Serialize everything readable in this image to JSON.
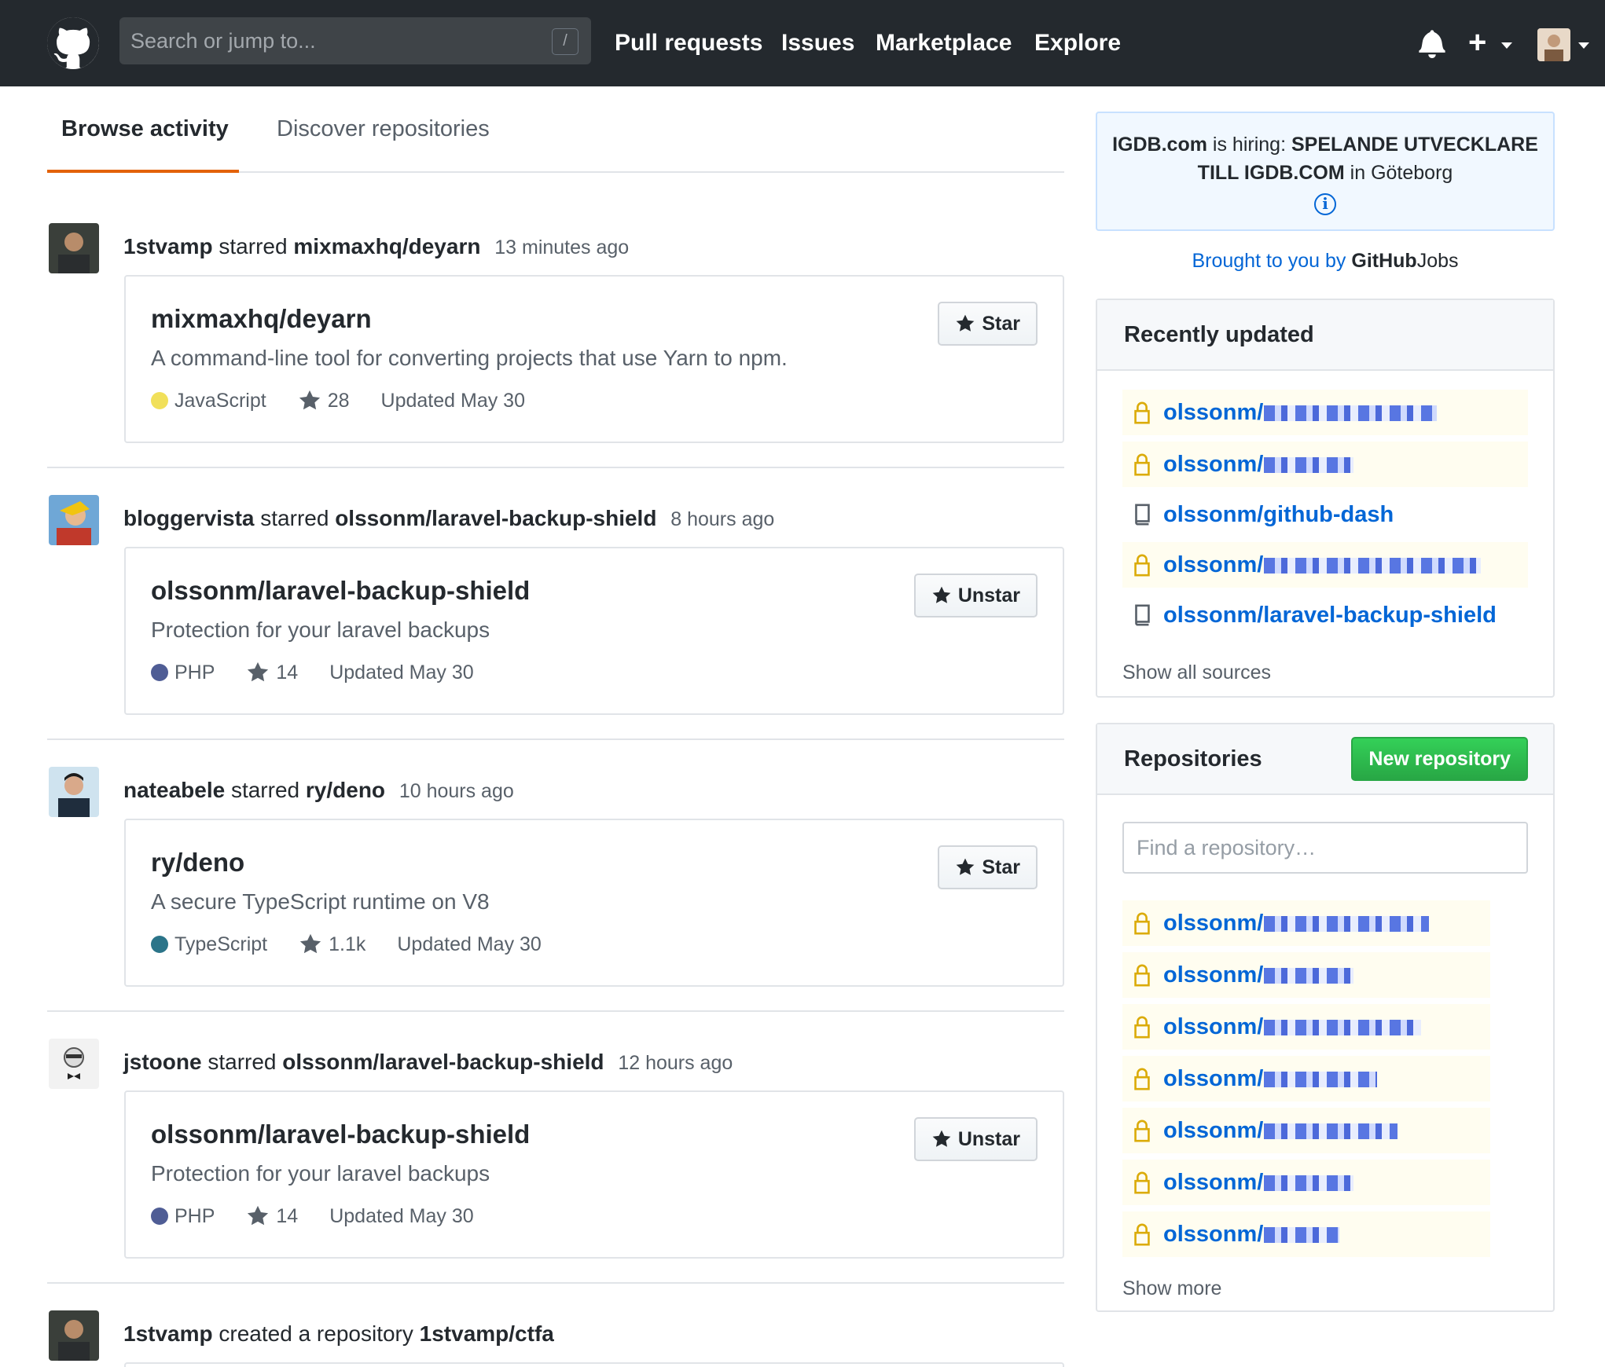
{
  "header": {
    "search_placeholder": "Search or jump to...",
    "search_shortcut": "/",
    "nav": [
      "Pull requests",
      "Issues",
      "Marketplace",
      "Explore"
    ],
    "plus": "+"
  },
  "tabs": {
    "browse": "Browse activity",
    "discover": "Discover repositories"
  },
  "feed": [
    {
      "user": "1stvamp",
      "action": "starred",
      "target": "mixmaxhq/deyarn",
      "time": "13 minutes ago",
      "repo": "mixmaxhq/deyarn",
      "desc": "A command-line tool for converting projects that use Yarn to npm.",
      "lang": "JavaScript",
      "lang_color": "#f1e05a",
      "stars": "28",
      "updated": "Updated May 30",
      "button": "Star"
    },
    {
      "user": "bloggervista",
      "action": "starred",
      "target": "olssonm/laravel-backup-shield",
      "time": "8 hours ago",
      "repo": "olssonm/laravel-backup-shield",
      "desc": "Protection for your laravel backups",
      "lang": "PHP",
      "lang_color": "#4F5D95",
      "stars": "14",
      "updated": "Updated May 30",
      "button": "Unstar"
    },
    {
      "user": "nateabele",
      "action": "starred",
      "target": "ry/deno",
      "time": "10 hours ago",
      "repo": "ry/deno",
      "desc": "A secure TypeScript runtime on V8",
      "lang": "TypeScript",
      "lang_color": "#2b7489",
      "stars": "1.1k",
      "updated": "Updated May 30",
      "button": "Star"
    },
    {
      "user": "jstoone",
      "action": "starred",
      "target": "olssonm/laravel-backup-shield",
      "time": "12 hours ago",
      "repo": "olssonm/laravel-backup-shield",
      "desc": "Protection for your laravel backups",
      "lang": "PHP",
      "lang_color": "#4F5D95",
      "stars": "14",
      "updated": "Updated May 30",
      "button": "Unstar"
    },
    {
      "user": "1stvamp",
      "action": "created a repository",
      "target": "1stvamp/ctfa"
    }
  ],
  "jobs": {
    "company": "IGDB.com",
    "is_hiring": "is hiring:",
    "position": "SPELANDE UTVECKLARE TILL IGDB.COM",
    "in": "in",
    "location": "Göteborg",
    "brought": "Brought to you by",
    "brand_bold": "GitHub",
    "brand_light": "Jobs"
  },
  "recently_updated": {
    "title": "Recently updated",
    "items": [
      {
        "label": "olssonm/",
        "private": true
      },
      {
        "label": "olssonm/",
        "private": true
      },
      {
        "label": "olssonm/github-dash",
        "private": false
      },
      {
        "label": "olssonm/",
        "private": true
      },
      {
        "label": "olssonm/laravel-backup-shield",
        "private": false
      }
    ],
    "show_all": "Show all sources"
  },
  "repositories": {
    "title": "Repositories",
    "new_button": "New repository",
    "find_placeholder": "Find a repository…",
    "items": [
      "olssonm/",
      "olssonm/",
      "olssonm/",
      "olssonm/",
      "olssonm/",
      "olssonm/",
      "olssonm/"
    ],
    "show_more": "Show more"
  },
  "colors": {
    "header_bg": "#24292e",
    "tab_accent": "#e36209",
    "link_blue": "#0366d6",
    "new_button_green": "#28a745",
    "lock_gold": "#dbab09"
  }
}
